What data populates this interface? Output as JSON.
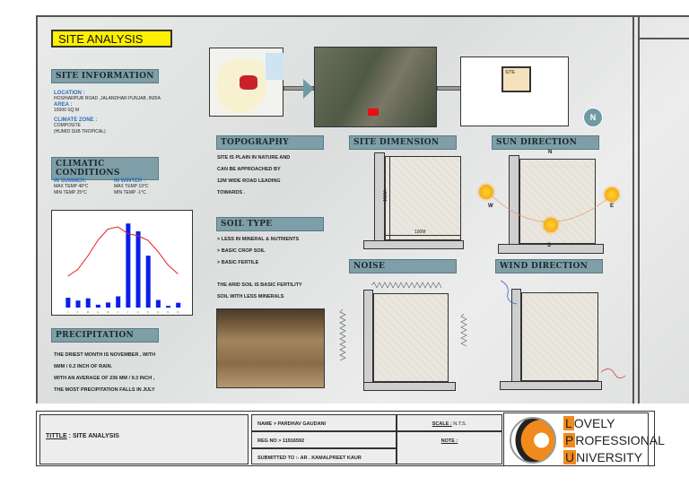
{
  "title": "SITE ANALYSIS",
  "site_info": {
    "heading": "SITE INFORMATION",
    "location_label": "LOCATION :",
    "location": "HOSHIARPUR ROAD ,JALANDHAR PUNJAB ,INDIA",
    "area_label": "AREA :",
    "area": "15000 SQ M",
    "climate_label": "CLIMATE ZONE :",
    "climate": "COMPOSITE",
    "climate_sub": "(HUMID SUB TROPICAL)"
  },
  "climatic": {
    "heading": "CLIMATIC CONDITIONS",
    "summer_label": "IN SUMMER:",
    "summer_max": "MAX TEMP 48°C",
    "summer_min": "MIN TEMP 25°C",
    "winter_label": "IN WINTER :",
    "winter_max": "MAX TEMP 19°C",
    "winter_min": "MIN  TEMP -1°C"
  },
  "chart_data": {
    "type": "bar",
    "categories": [
      "J",
      "F",
      "M",
      "A",
      "M",
      "J",
      "J",
      "A",
      "S",
      "O",
      "N",
      "D"
    ],
    "series": [
      {
        "name": "Precipitation",
        "type": "bar",
        "color": "#0a1ee8",
        "values": [
          35,
          25,
          33,
          10,
          18,
          40,
          300,
          272,
          185,
          27,
          6,
          17
        ]
      },
      {
        "name": "Temperature",
        "type": "line",
        "color": "#e02020",
        "values": [
          14,
          17,
          23,
          30,
          35,
          36,
          33,
          32,
          30,
          25,
          19,
          15
        ]
      }
    ],
    "ylim": [
      0,
      320
    ],
    "y2lim": [
      0,
      40
    ]
  },
  "precipitation": {
    "heading": "PRECIPITATION",
    "lines": [
      "THE DRIEST MONTH IS NOVEMBER , WITH",
      "6MM / 0.2 INCH OF RAIN.",
      "WITH AN AVERAGE OF 236 MM / 9.3 INCH ,",
      "THE MOST PRECIPITATION FALLS IN JULY"
    ]
  },
  "topography": {
    "heading": "TOPOGRAPHY",
    "lines": [
      "SITE IS PLAIN IN NATURE AND",
      "CAN BE APPROACHED  BY",
      "12M WIDE ROAD LEADING",
      "TOWARDS ."
    ]
  },
  "soil": {
    "heading": "SOIL TYPE",
    "items": [
      "> LESS IN MINERAL & NUTRIENTS",
      "> BASIC CROP SOIL",
      "> BASIC FERTILE"
    ],
    "lines": [
      "THE ARID SOIL IS BASIC FERTILITY",
      "SOIL WITH  LESS MINERALS"
    ]
  },
  "site_dimension": {
    "heading": "SITE DIMENSION",
    "width": "100M",
    "height": "150M"
  },
  "sun": {
    "heading": "SUN DIRECTION",
    "n": "N",
    "s": "S",
    "e": "E",
    "w": "W"
  },
  "noise": {
    "heading": "NOISE"
  },
  "wind": {
    "heading": "WIND DIRECTION"
  },
  "compass": "N",
  "site_map_label": "SITE",
  "titleblock": {
    "title_label": "TITTLE",
    "title": ": SITE ANALYSIS",
    "name": "NAME > PARDHAV GAUDANI",
    "reg": "REG NO > 11916592",
    "submitted": "SUBMITTED TO :- AR . KAMALPREET KAUR",
    "scale_label": "SCALE :",
    "scale": "N.T.S.",
    "note_label": "NOTE :",
    "logo_l": "L",
    "logo_l_rest": "OVELY",
    "logo_p": "P",
    "logo_p_rest": "ROFESSIONAL",
    "logo_u": "U",
    "logo_u_rest": "NIVERSITY"
  },
  "colors": {
    "accent": "#ffef00",
    "heading": "#7f9fa8",
    "logo": "#f08a1c"
  }
}
